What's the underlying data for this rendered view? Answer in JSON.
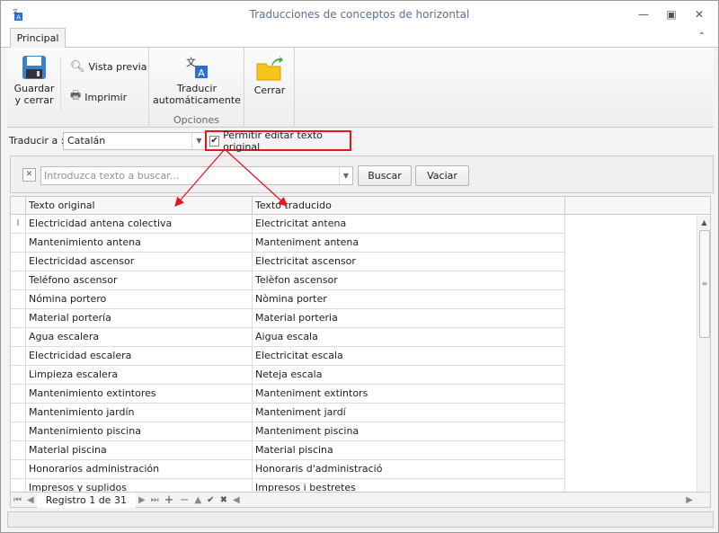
{
  "window": {
    "title": "Traducciones de conceptos de horizontal"
  },
  "tabs": [
    {
      "label": "Principal"
    }
  ],
  "ribbon": {
    "save": "Guardar\ny cerrar",
    "save_l1": "Guardar",
    "save_l2": "y cerrar",
    "preview": "Vista previa",
    "print": "Imprimir",
    "translate_l1": "Traducir",
    "translate_l2": "automáticamente",
    "options_group": "Opciones",
    "close": "Cerrar"
  },
  "toolbar": {
    "translate_to_label": "Traducir a :",
    "language": "Catalán",
    "allow_edit_label": "Permitir editar texto original",
    "allow_edit_checked": true
  },
  "search": {
    "placeholder": "Introduzca texto a buscar...",
    "search_btn": "Buscar",
    "clear_btn": "Vaciar"
  },
  "grid": {
    "columns": [
      "Texto original",
      "Texto traducido"
    ],
    "rows": [
      [
        "Electricidad antena colectiva",
        "Electricitat antena"
      ],
      [
        "Mantenimiento antena",
        "Manteniment antena"
      ],
      [
        "Electricidad ascensor",
        "Electricitat ascensor"
      ],
      [
        "Teléfono ascensor",
        "Telèfon ascensor"
      ],
      [
        "Nómina portero",
        "Nòmina porter"
      ],
      [
        "Material portería",
        "Material porteria"
      ],
      [
        "Agua escalera",
        "Aigua escala"
      ],
      [
        "Electricidad escalera",
        "Electricitat escala"
      ],
      [
        "Limpieza escalera",
        "Neteja escala"
      ],
      [
        "Mantenimiento extintores",
        "Manteniment extintors"
      ],
      [
        "Mantenimiento jardín",
        "Manteniment jardí"
      ],
      [
        "Mantenimiento piscina",
        "Manteniment piscina"
      ],
      [
        "Material piscina",
        "Material piscina"
      ],
      [
        "Honorarios administración",
        "Honoraris d'administració"
      ],
      [
        "Impresos y suplidos",
        "Impresos i bestretes"
      ]
    ]
  },
  "navigator": {
    "record": "Registro 1 de 31"
  },
  "colors": {
    "highlight": "#e8151d",
    "title": "#5a6f99"
  }
}
